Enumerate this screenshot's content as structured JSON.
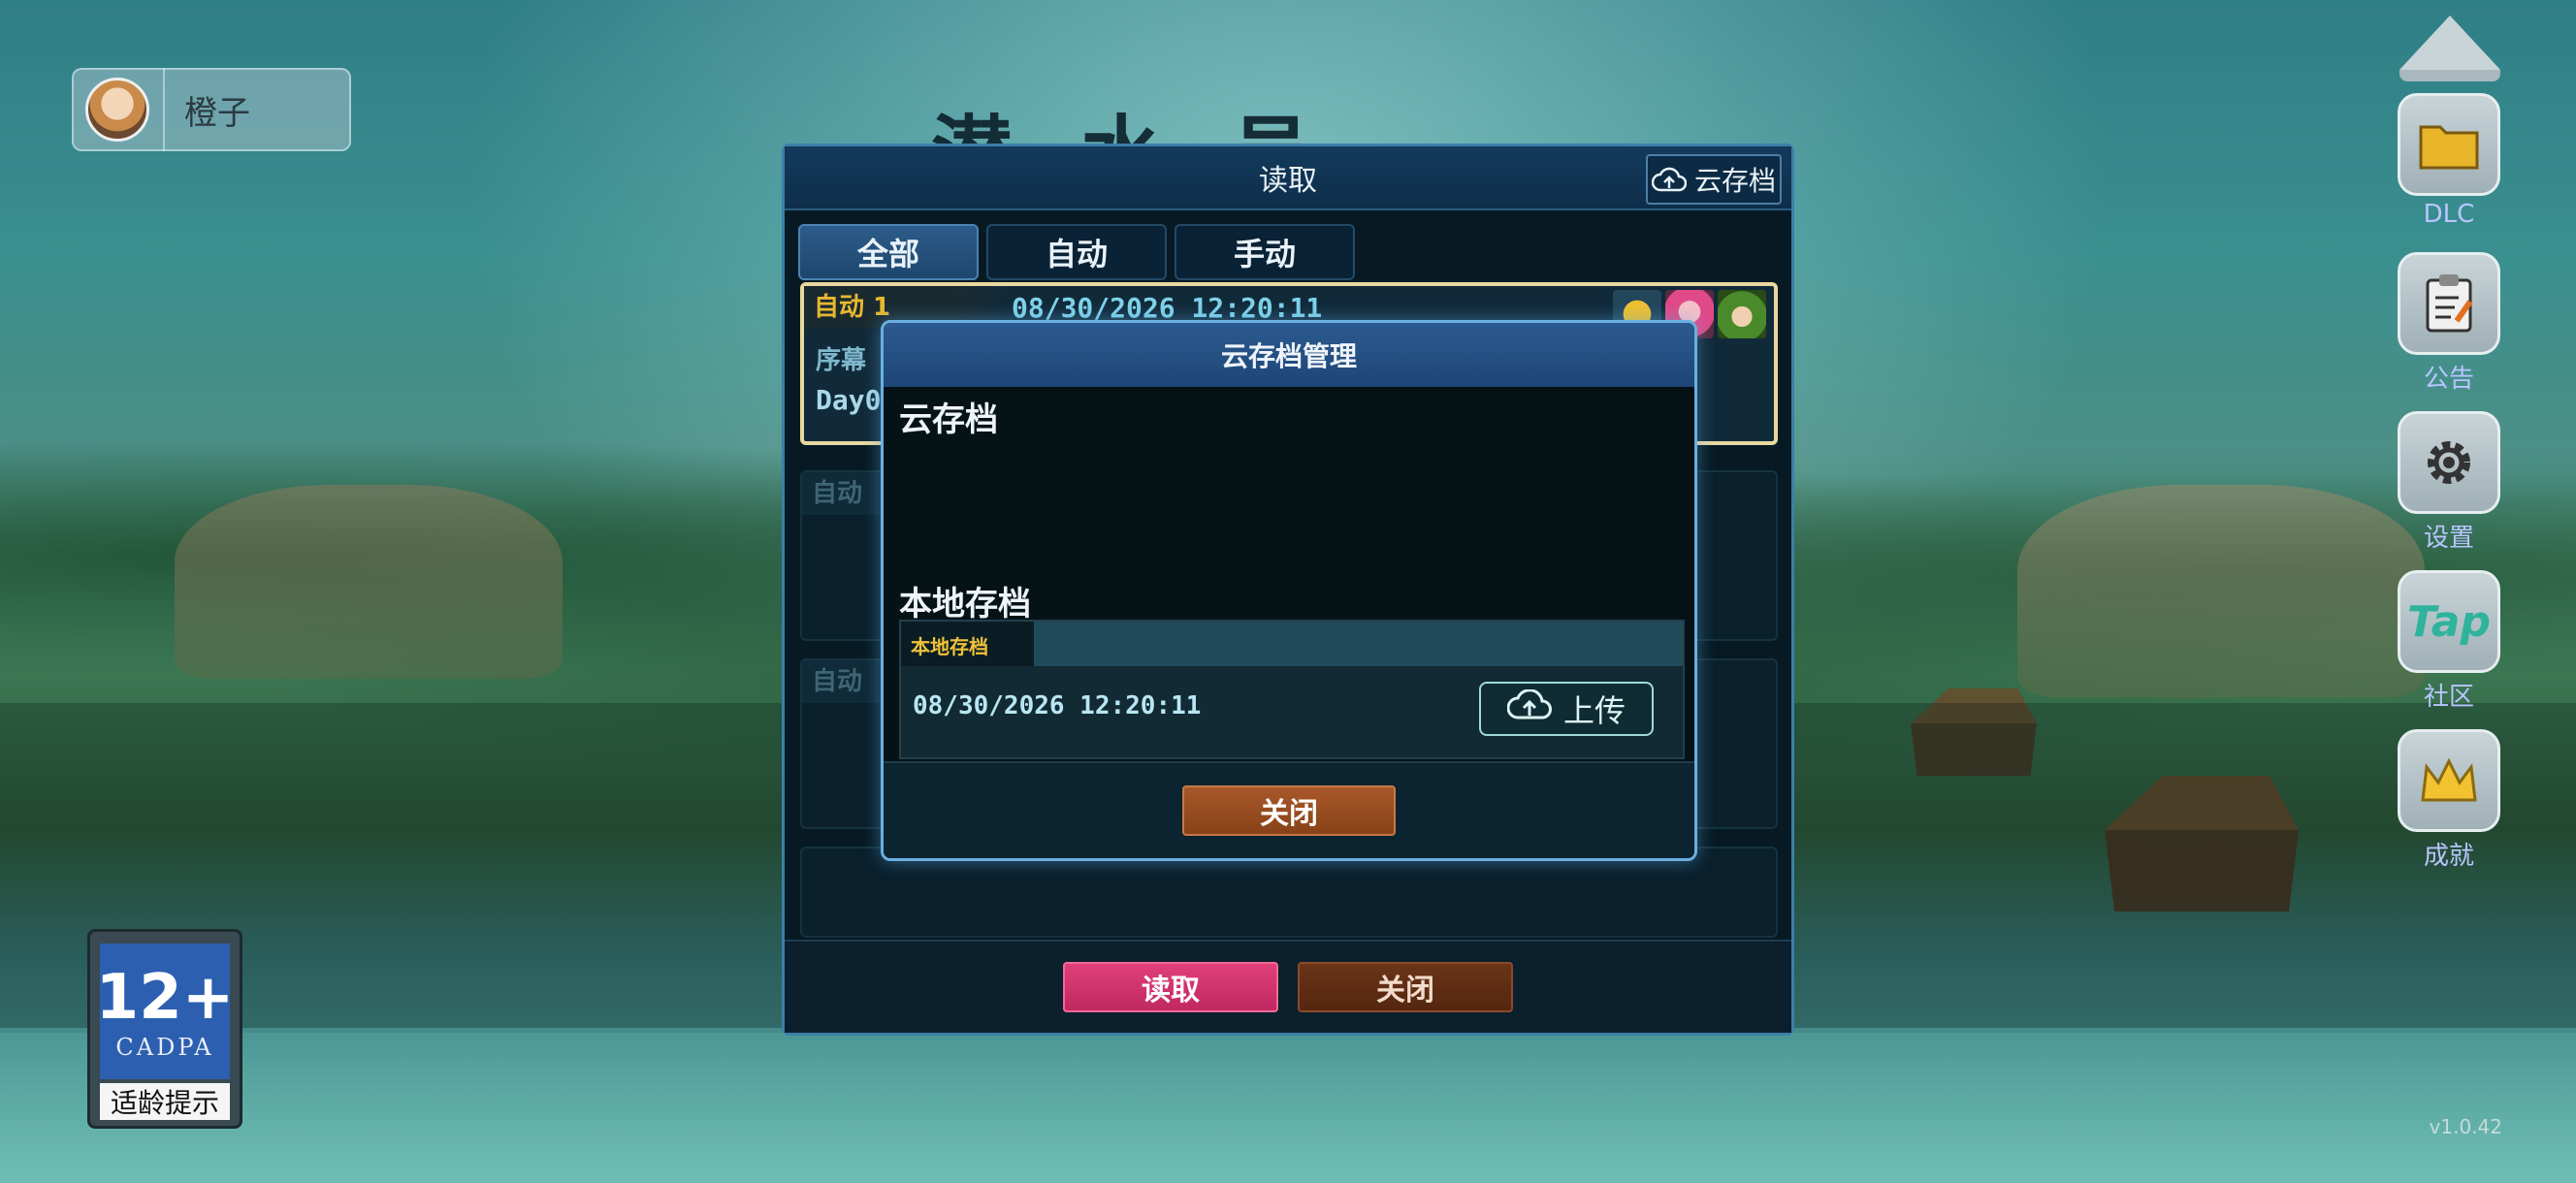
{
  "player": {
    "name": "橙子"
  },
  "game_title": "潜水员",
  "side_menu": [
    {
      "label": "DLC",
      "icon": "folder-icon"
    },
    {
      "label": "公告",
      "icon": "clipboard-icon"
    },
    {
      "label": "设置",
      "icon": "gear-icon"
    },
    {
      "label": "社区",
      "icon": "tap-icon",
      "tile_text": "Tap"
    },
    {
      "label": "成就",
      "icon": "crown-icon"
    }
  ],
  "age_rating": {
    "age": "12+",
    "org": "CADPA",
    "caption": "适龄提示"
  },
  "read_panel": {
    "title": "读取",
    "cloud_button": "云存档",
    "tabs": [
      "全部",
      "自动",
      "手动"
    ],
    "active_tab": "全部",
    "slots": [
      {
        "tag": "自动 1",
        "date": "08/30/2026 12:20:11",
        "chapter": "序幕",
        "day": "Day0"
      },
      {
        "tag": "自动"
      },
      {
        "tag": "自动"
      },
      {
        "tag": ""
      }
    ],
    "read_button": "读取",
    "close_button": "关闭"
  },
  "cloud_dialog": {
    "title": "云存档管理",
    "cloud_section": "云存档",
    "local_section": "本地存档",
    "local_card": {
      "tag": "本地存档",
      "date": "08/30/2026 12:20:11",
      "upload_button": "上传"
    },
    "close_button": "关闭"
  },
  "version": "v1.0.42",
  "colors": {
    "accent": "#3c7fa8",
    "read_button": "#d0306c",
    "close_button": "#8a4a1e",
    "gold_tag": "#e9b830"
  }
}
